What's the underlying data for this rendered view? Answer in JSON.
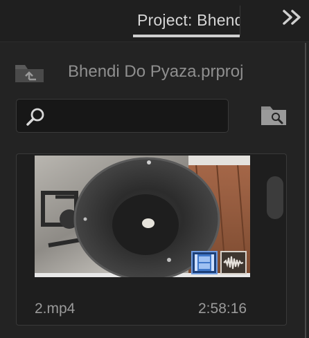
{
  "panel": {
    "tab_label": "Project: Bhendi Do Pyaza"
  },
  "project": {
    "name": "Bhendi Do Pyaza.prproj"
  },
  "search": {
    "value": "",
    "placeholder": ""
  },
  "clips": [
    {
      "name": "2.mp4",
      "duration": "2:58:16",
      "has_video": true,
      "has_audio": true
    }
  ],
  "icons": {
    "overflow": "double-chevron-right-icon",
    "navigate_up": "folder-up-icon",
    "search": "magnifier-icon",
    "find": "folder-search-icon",
    "video_badge": "filmstrip-icon",
    "audio_badge": "waveform-icon"
  },
  "colors": {
    "panel_bg": "#232323",
    "video_badge": "#1c3f78",
    "audio_badge": "#3e362f"
  }
}
